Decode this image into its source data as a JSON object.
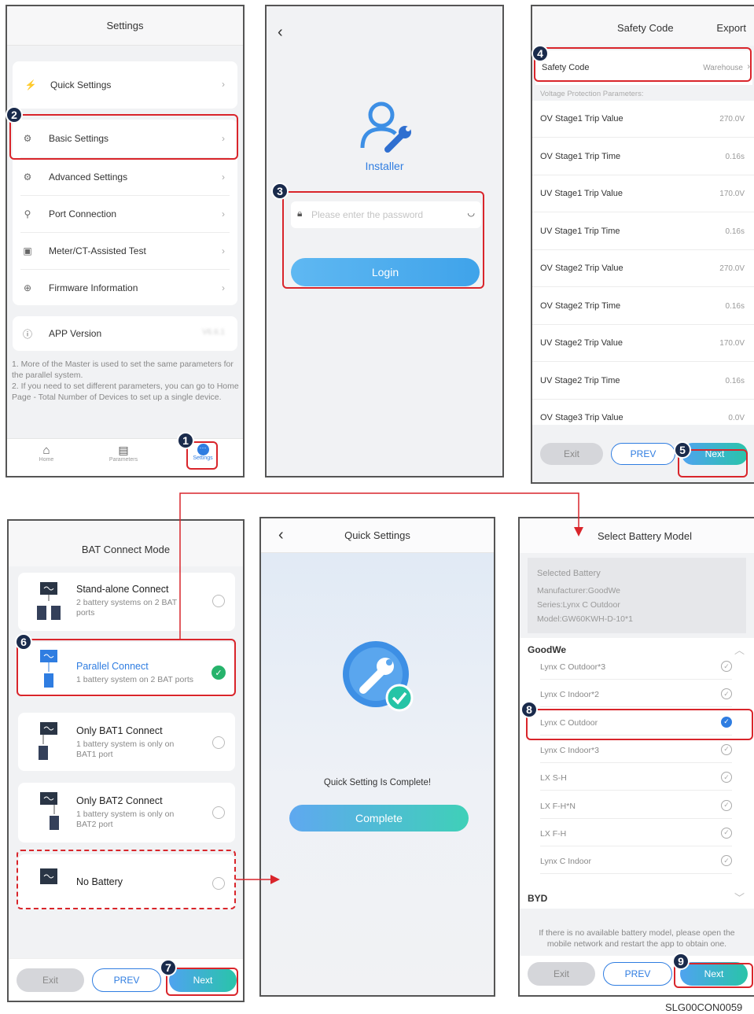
{
  "p1": {
    "title": "Settings",
    "items": [
      "Quick Settings",
      "Basic Settings",
      "Advanced Settings",
      "Port Connection",
      "Meter/CT-Assisted Test",
      "Firmware Information"
    ],
    "app_version_label": "APP Version",
    "app_version_value": "V6.6.1",
    "note": "1. More of the Master is used to set the same parameters for the parallel system.\n2. If you need to set different parameters, you can go to Home Page - Total Number of Devices to set up a single device.",
    "nav": [
      "Home",
      "Parameters",
      "Settings"
    ]
  },
  "p2": {
    "back": "‹",
    "role": "Installer",
    "password_placeholder": "Please enter the password",
    "login": "Login"
  },
  "p3": {
    "title": "Safety Code",
    "export": "Export",
    "safety_label": "Safety Code",
    "safety_value": "Warehouse",
    "section": "Voltage Protection Parameters:",
    "params": [
      {
        "name": "OV Stage1 Trip Value",
        "value": "270.0V"
      },
      {
        "name": "OV Stage1 Trip Time",
        "value": "0.16s"
      },
      {
        "name": "UV Stage1 Trip Value",
        "value": "170.0V"
      },
      {
        "name": "UV Stage1 Trip Time",
        "value": "0.16s"
      },
      {
        "name": "OV Stage2 Trip Value",
        "value": "270.0V"
      },
      {
        "name": "OV Stage2 Trip Time",
        "value": "0.16s"
      },
      {
        "name": "UV Stage2 Trip Value",
        "value": "170.0V"
      },
      {
        "name": "UV Stage2 Trip Time",
        "value": "0.16s"
      },
      {
        "name": "OV Stage3 Trip Value",
        "value": "0.0V"
      }
    ],
    "exit": "Exit",
    "prev": "PREV",
    "next": "Next"
  },
  "p4": {
    "title": "BAT Connect Mode",
    "modes": [
      {
        "title": "Stand-alone Connect",
        "desc": "2 battery systems on 2 BAT ports"
      },
      {
        "title": "Parallel Connect",
        "desc": "1 battery system on 2 BAT ports"
      },
      {
        "title": "Only BAT1 Connect",
        "desc": "1 battery system is only on BAT1 port"
      },
      {
        "title": "Only BAT2 Connect",
        "desc": "1 battery system is only on BAT2 port"
      },
      {
        "title": "No Battery",
        "desc": ""
      }
    ],
    "exit": "Exit",
    "prev": "PREV",
    "next": "Next"
  },
  "p5": {
    "back": "‹",
    "title": "Quick Settings",
    "complete_text": "Quick Setting Is Complete!",
    "complete_btn": "Complete"
  },
  "p6": {
    "title": "Select Battery Model",
    "selected_title": "Selected Battery",
    "manufacturer": "Manufacturer:GoodWe",
    "series": "Series:Lynx C Outdoor",
    "model": "Model:GW60KWH-D-10*1",
    "brand1": "GoodWe",
    "models": [
      "Lynx C Outdoor*3",
      "Lynx C Indoor*2",
      "Lynx C Outdoor",
      "Lynx C Indoor*3",
      "LX S-H",
      "LX F-H*N",
      "LX F-H",
      "Lynx C Indoor"
    ],
    "brand2": "BYD",
    "note": "If there is no available battery model, please open the mobile network and restart the app to obtain one.",
    "exit": "Exit",
    "prev": "PREV",
    "next": "Next"
  },
  "steps": [
    "1",
    "2",
    "3",
    "4",
    "5",
    "6",
    "7",
    "8",
    "9"
  ],
  "footer_code": "SLG00CON0059",
  "colors": {
    "accent": "#2f7de1",
    "highlight": "#d9252b",
    "badge": "#1a2b4c"
  }
}
